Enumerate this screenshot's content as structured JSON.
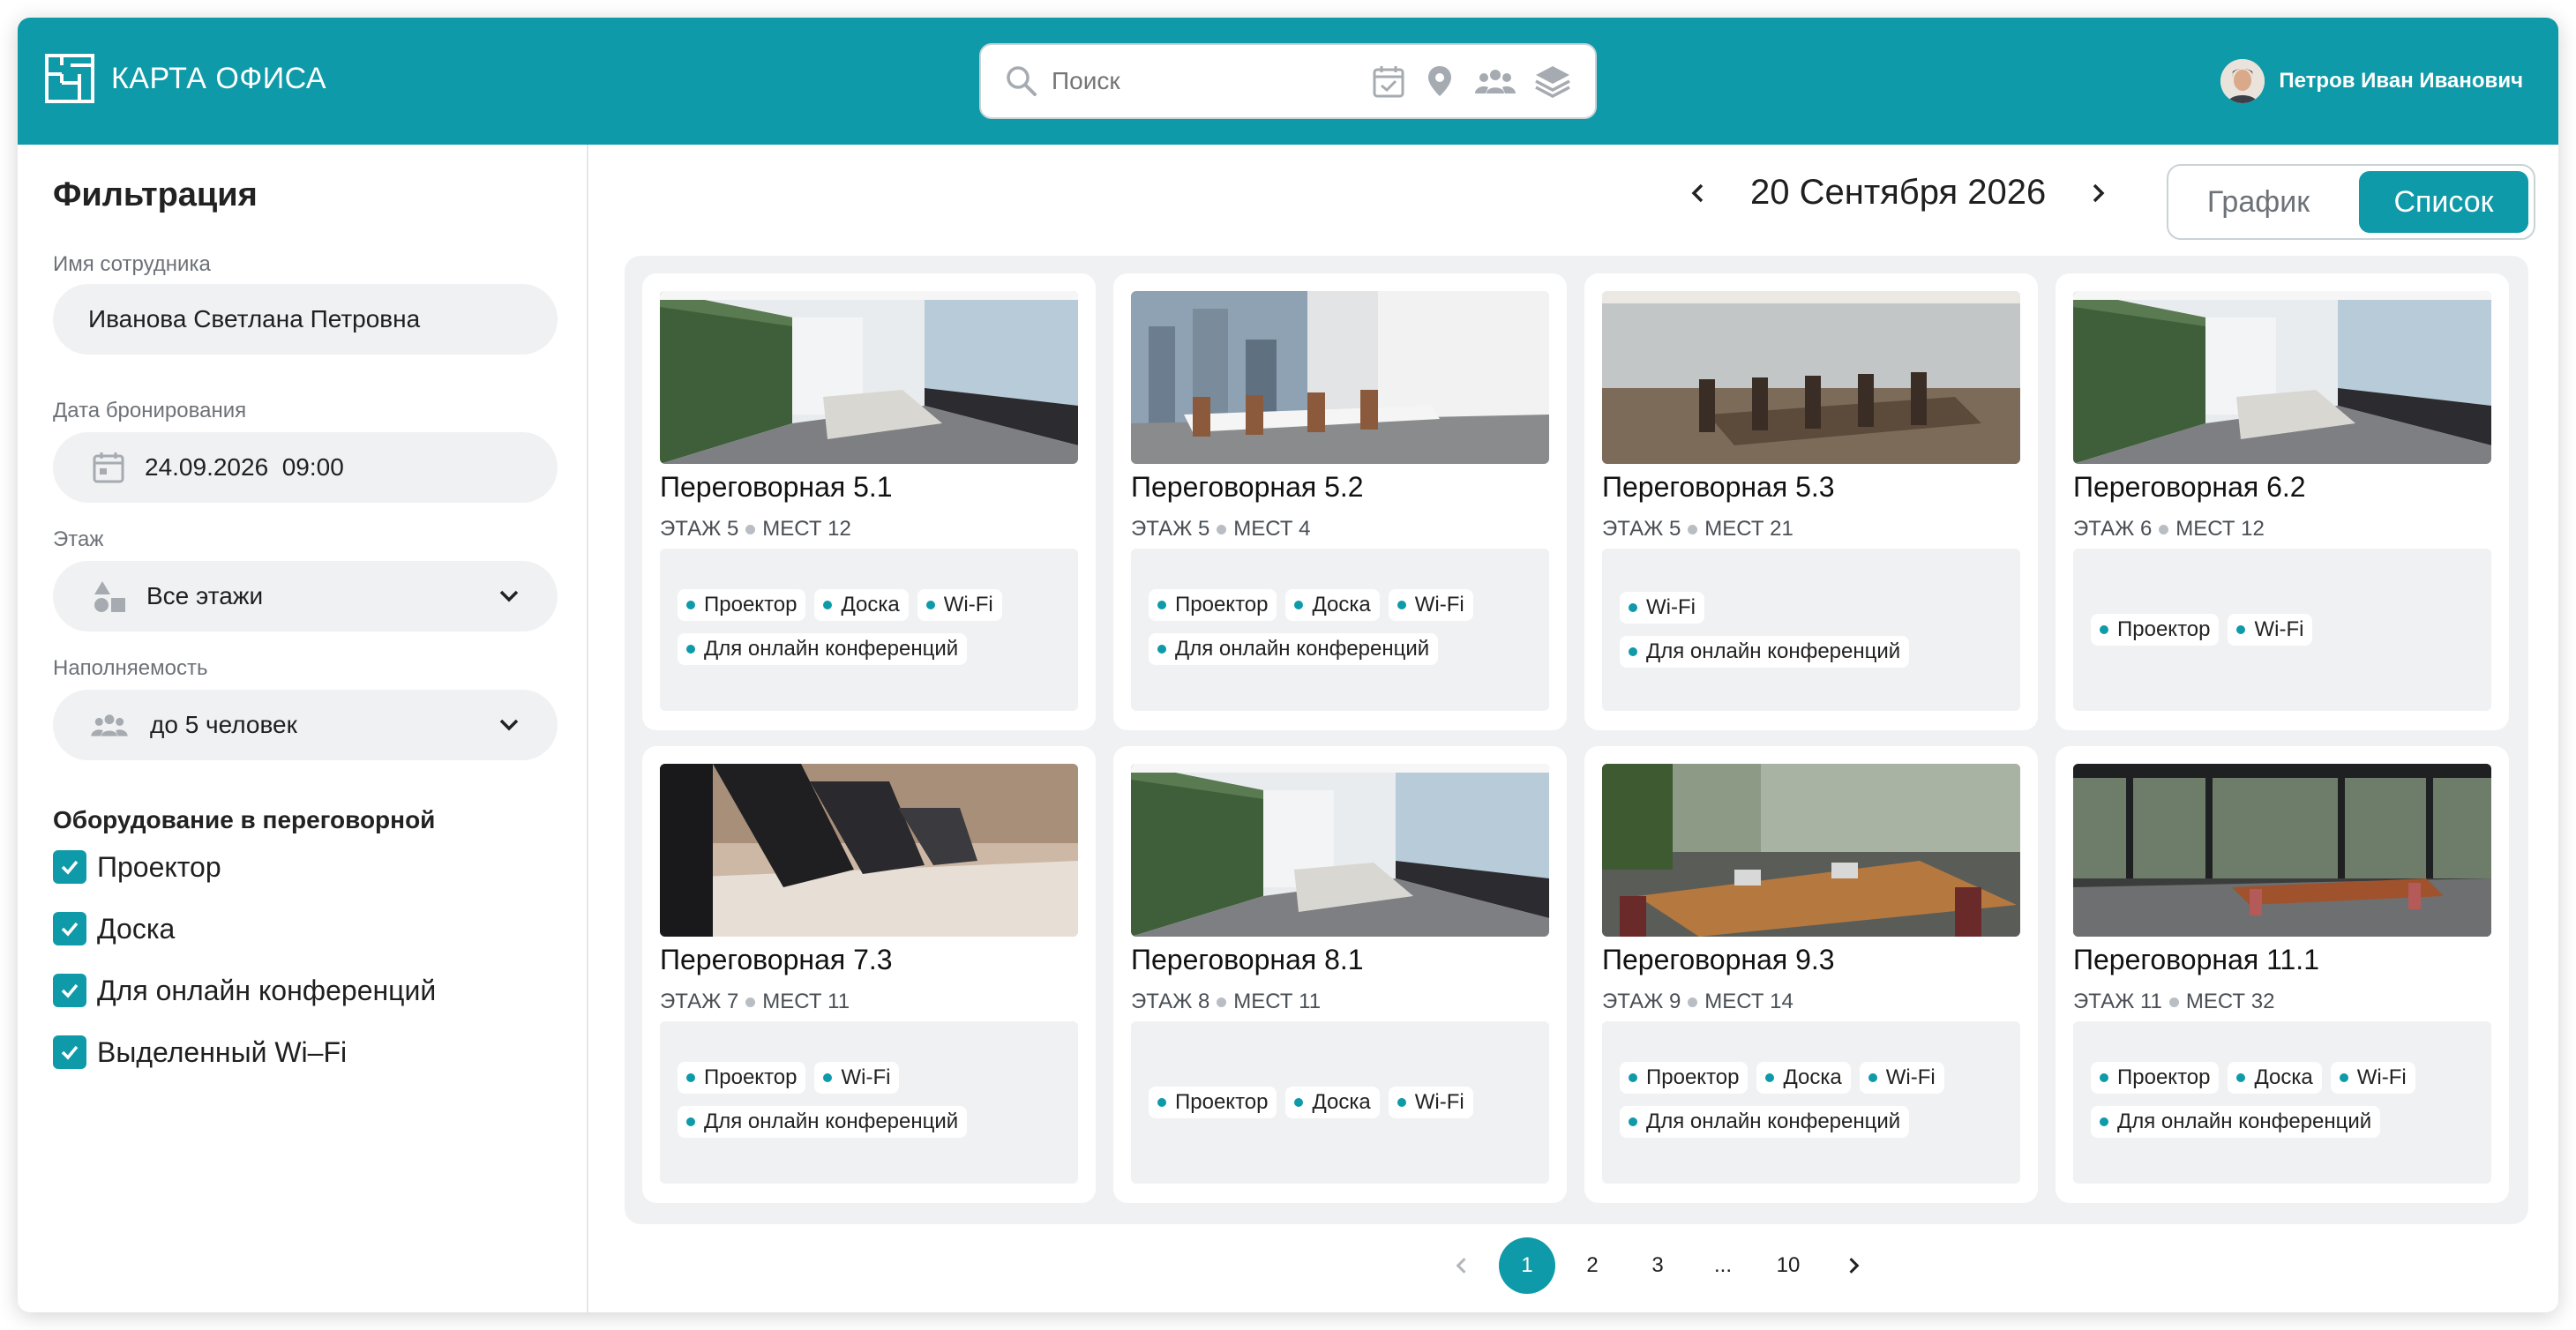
{
  "header": {
    "logo_text": "КАРТА ОФИСА",
    "search_placeholder": "Поиск",
    "search_tools": [
      "calendar-icon",
      "location-pin-icon",
      "people-icon",
      "layers-icon"
    ],
    "user_name": "Петров Иван Иванович"
  },
  "sidebar": {
    "title": "Фильтрация",
    "employee_label": "Имя сотрудника",
    "employee_value": "Иванова Светлана Петровна",
    "date_label": "Дата бронирования",
    "date_value": "24.09.2026  09:00",
    "floor_label": "Этаж",
    "floor_value": "Все этажи",
    "capacity_label": "Наполняемость",
    "capacity_value": "до 5 человек",
    "equipment_title": "Оборудование в переговорной",
    "equipment": [
      {
        "label": "Проектор",
        "checked": true
      },
      {
        "label": "Доска",
        "checked": true
      },
      {
        "label": "Для онлайн конференций",
        "checked": true
      },
      {
        "label": "Выделенный Wi–Fi",
        "checked": true
      }
    ]
  },
  "main": {
    "date": "20 Сентября 2026",
    "view_toggle": {
      "schedule": "График",
      "list": "Список",
      "active": "list"
    },
    "rooms": [
      {
        "title": "Переговорная 5.1",
        "floor": "ЭТАЖ 5",
        "seats": "МЕСТ 12",
        "tags": [
          "Проектор",
          "Доска",
          "Wi-Fi",
          "Для онлайн конференций"
        ]
      },
      {
        "title": "Переговорная 5.2",
        "floor": "ЭТАЖ 5",
        "seats": "МЕСТ 4",
        "tags": [
          "Проектор",
          "Доска",
          "Wi-Fi",
          "Для онлайн конференций"
        ]
      },
      {
        "title": "Переговорная 5.3",
        "floor": "ЭТАЖ 5",
        "seats": "МЕСТ 21",
        "tags": [
          "Wi-Fi",
          "Для онлайн конференций"
        ]
      },
      {
        "title": "Переговорная 6.2",
        "floor": "ЭТАЖ 6",
        "seats": "МЕСТ 12",
        "tags": [
          "Проектор",
          "Wi-Fi"
        ]
      },
      {
        "title": "Переговорная 7.3",
        "floor": "ЭТАЖ 7",
        "seats": "МЕСТ 11",
        "tags": [
          "Проектор",
          "Wi-Fi",
          "Для онлайн конференций"
        ]
      },
      {
        "title": "Переговорная 8.1",
        "floor": "ЭТАЖ 8",
        "seats": "МЕСТ 11",
        "tags": [
          "Проектор",
          "Доска",
          "Wi-Fi"
        ]
      },
      {
        "title": "Переговорная 9.3",
        "floor": "ЭТАЖ 9",
        "seats": "МЕСТ 14",
        "tags": [
          "Проектор",
          "Доска",
          "Wi-Fi",
          "Для онлайн конференций"
        ]
      },
      {
        "title": "Переговорная 11.1",
        "floor": "ЭТАЖ 11",
        "seats": "МЕСТ 32",
        "tags": [
          "Проектор",
          "Доска",
          "Wi-Fi",
          "Для онлайн конференций"
        ]
      }
    ],
    "pagination": {
      "pages": [
        "1",
        "2",
        "3",
        "...",
        "10"
      ],
      "current": "1"
    }
  },
  "colors": {
    "accent": "#0e9aa8",
    "panel": "#f0f1f3"
  }
}
